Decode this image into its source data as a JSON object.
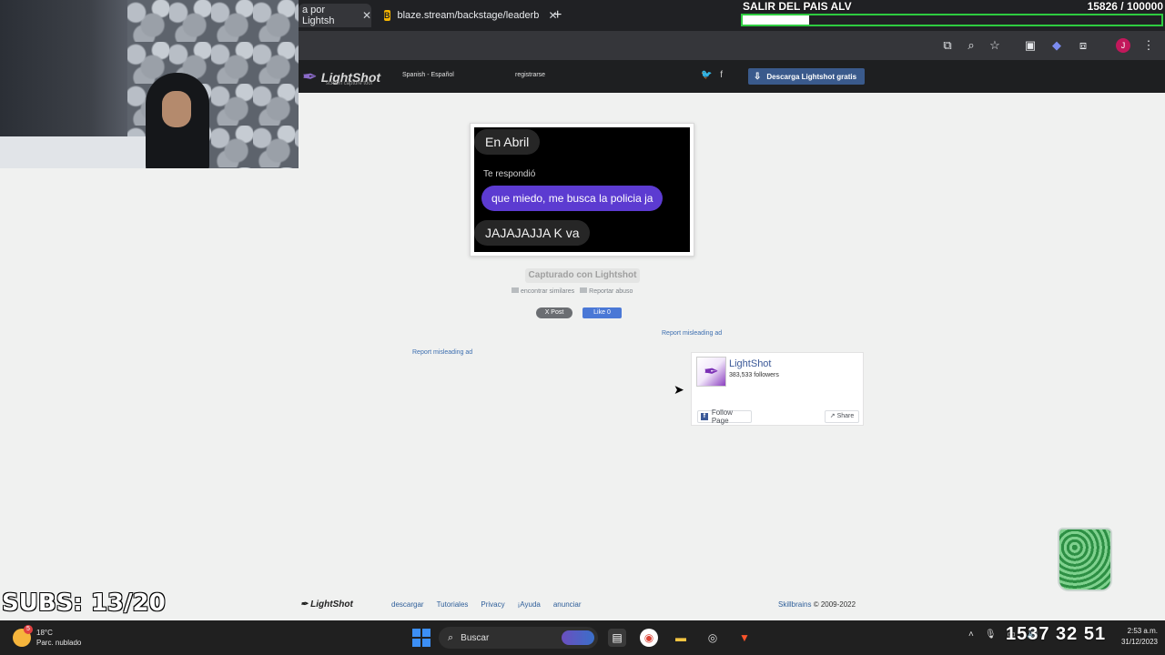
{
  "browser": {
    "tabs": [
      {
        "label": "a por Lightsh"
      },
      {
        "label": "blaze.stream/backstage/leaderb"
      }
    ],
    "new_tab": "+"
  },
  "overlay": {
    "goal_title": "SALIR DEL PAIS ALV",
    "goal_count": "15826 / 100000",
    "goal_progress": 0.158,
    "subs": "SUBS: 13/20",
    "clock_big": "1537  32  51"
  },
  "lightshot": {
    "logo": "LightShot",
    "tagline": "screen capture tool",
    "language": "Spanish - Español",
    "register": "registrarse",
    "download": "Descarga Lightshot gratis",
    "captured": "Capturado con Lightshot",
    "find_similar": "encontrar similares",
    "report_abuse": "Reportar abuso",
    "post": "X Post",
    "like": "Like 0",
    "report_ad_1": "Report misleading ad",
    "report_ad_2": "Report misleading ad"
  },
  "screenshot": {
    "bubble_top": "En Abril",
    "reply_label": "Te respondió",
    "reply_text": "que miedo, me busca la policia ja",
    "bubble_bottom": "JAJAJAJJA K va"
  },
  "facebook": {
    "page_name": "LightShot",
    "followers": "383,533 followers",
    "follow": "Follow Page",
    "share": "Share"
  },
  "footer": {
    "logo": "LightShot",
    "links": [
      "descargar",
      "Tutoriales",
      "Privacy",
      "¡Ayuda",
      "anunciar"
    ],
    "brand": "Skillbrains",
    "copyright": "© 2009-2022"
  },
  "taskbar": {
    "temperature": "18°C",
    "weather": "Parc. nublado",
    "weather_badge": "5",
    "search": "Buscar",
    "time": "2:53 a.m.",
    "date": "31/12/2023"
  }
}
